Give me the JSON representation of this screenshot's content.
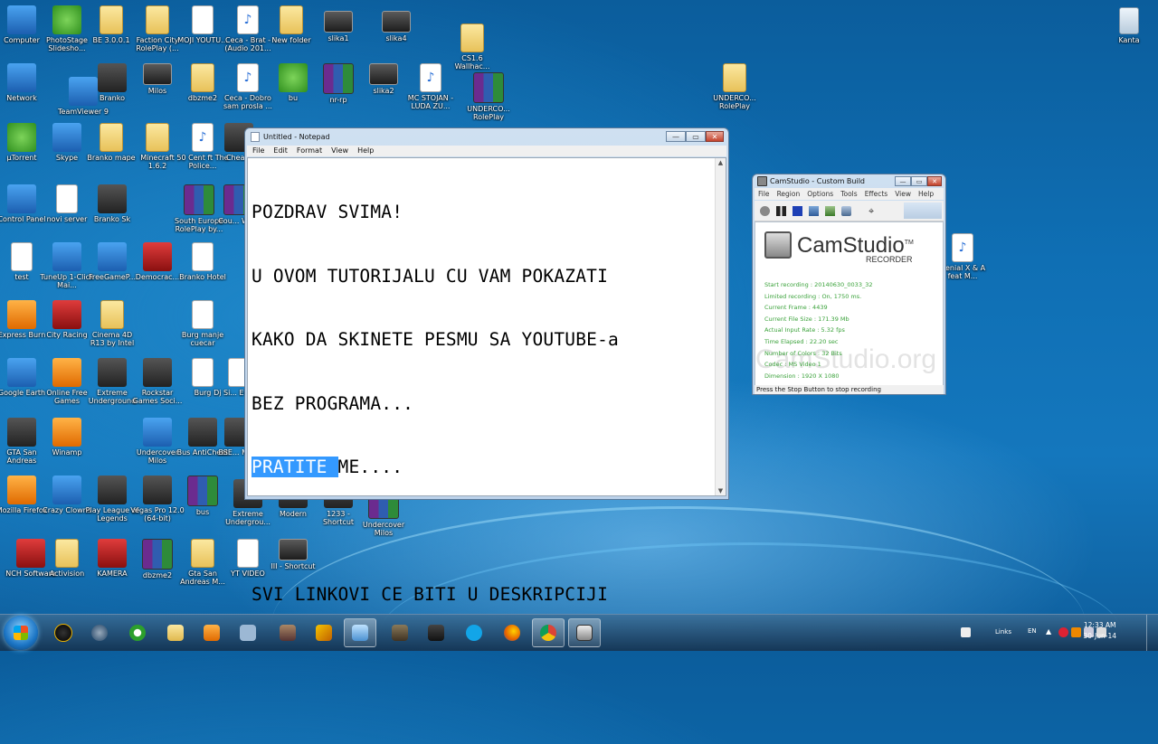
{
  "desktop": {
    "icons": [
      {
        "label": "Computer",
        "glyph": "computer-icon",
        "color": "#5aa0e0"
      },
      {
        "label": "PhotoStage Slidesho...",
        "glyph": "photostage-icon",
        "color": "#2e8b3a"
      },
      {
        "label": "BE 3.0.0.1",
        "glyph": "folder-icon"
      },
      {
        "label": "Faction City RolePlay (...",
        "glyph": "folder-icon"
      },
      {
        "label": "MOJI YOUTU...",
        "glyph": "document-icon"
      },
      {
        "label": "Ceca - Brat - (Audio 201...",
        "glyph": "mp3-icon"
      },
      {
        "label": "New folder",
        "glyph": "folder-icon"
      },
      {
        "label": "slika1",
        "glyph": "image-icon"
      },
      {
        "label": "slika4",
        "glyph": "image-icon"
      },
      {
        "label": "CS1.6 Wallhac...",
        "glyph": "folder-icon"
      },
      {
        "label": "Kanta",
        "glyph": "recycle-bin-icon"
      },
      {
        "label": "Network",
        "glyph": "network-icon"
      },
      {
        "label": "TeamViewer 9",
        "glyph": "teamviewer-icon"
      },
      {
        "label": "Branko",
        "glyph": "app-icon"
      },
      {
        "label": "Milos",
        "glyph": "image-icon"
      },
      {
        "label": "dbzme2",
        "glyph": "folder-icon"
      },
      {
        "label": "Ceca - Dobro sam prosla ...",
        "glyph": "mp3-icon"
      },
      {
        "label": "bu",
        "glyph": "chrome-icon"
      },
      {
        "label": "nr-rp",
        "glyph": "winrar-icon"
      },
      {
        "label": "slika2",
        "glyph": "image-icon"
      },
      {
        "label": "MC STOJAN - LUDA ZU...",
        "glyph": "mp3-icon"
      },
      {
        "label": "UNDERCO... RolePlay",
        "glyph": "winrar-icon"
      },
      {
        "label": "UNDERCO... RolePlay",
        "glyph": "folder-icon"
      },
      {
        "label": "µTorrent",
        "glyph": "utorrent-icon"
      },
      {
        "label": "Skype",
        "glyph": "skype-icon"
      },
      {
        "label": "Branko mape",
        "glyph": "folder-icon"
      },
      {
        "label": "Minecraft 1.6.2",
        "glyph": "folder-icon"
      },
      {
        "label": "50 Cent ft The Police...",
        "glyph": "mp3-icon"
      },
      {
        "label": "Chea...",
        "glyph": "app-icon"
      },
      {
        "label": "Control Panel",
        "glyph": "control-panel-icon"
      },
      {
        "label": "novi server",
        "glyph": "document-icon"
      },
      {
        "label": "Branko Sk",
        "glyph": "app-icon"
      },
      {
        "label": "South Europe RolePlay by...",
        "glyph": "winrar-icon"
      },
      {
        "label": "Cou... Wo...",
        "glyph": "winrar-icon"
      },
      {
        "label": "test",
        "glyph": "document-icon"
      },
      {
        "label": "TuneUp 1-Click Mai...",
        "glyph": "tuneup-icon"
      },
      {
        "label": "FreeGameP...",
        "glyph": "freegame-icon"
      },
      {
        "label": "Democrac...",
        "glyph": "democracy-icon"
      },
      {
        "label": "Branko Hotel",
        "glyph": "document-icon"
      },
      {
        "label": "Express Burn",
        "glyph": "express-burn-icon"
      },
      {
        "label": "City Racing",
        "glyph": "city-racing-icon"
      },
      {
        "label": "Cinema 4D R13 by Intel",
        "glyph": "folder-icon"
      },
      {
        "label": "Burg manje cuecar",
        "glyph": "document-icon"
      },
      {
        "label": "Google Earth",
        "glyph": "google-earth-icon"
      },
      {
        "label": "Online Free Games",
        "glyph": "online-games-icon"
      },
      {
        "label": "Extreme Underground",
        "glyph": "car-icon"
      },
      {
        "label": "Rockstar Games Soci...",
        "glyph": "rockstar-icon"
      },
      {
        "label": "Burg",
        "glyph": "document-icon"
      },
      {
        "label": "Dj Si... Evan...",
        "glyph": "document-icon"
      },
      {
        "label": "GTA San Andreas",
        "glyph": "gta-icon"
      },
      {
        "label": "Winamp",
        "glyph": "winamp-icon"
      },
      {
        "label": "Undercover Milos",
        "glyph": "power-icon"
      },
      {
        "label": "Bus AntiCheat",
        "glyph": "bus-icon"
      },
      {
        "label": "BSE... Ma...",
        "glyph": "app-icon"
      },
      {
        "label": "Mozilla Firefox",
        "glyph": "firefox-icon"
      },
      {
        "label": "Crazy Clowns",
        "glyph": "joystick-icon"
      },
      {
        "label": "Play League of Legends",
        "glyph": "lol-icon"
      },
      {
        "label": "Vegas Pro 12.0 (64-bit)",
        "glyph": "vegas-icon"
      },
      {
        "label": "bus",
        "glyph": "winrar-icon"
      },
      {
        "label": "Extreme Undergrou...",
        "glyph": "car-icon"
      },
      {
        "label": "Modern",
        "glyph": "app-icon"
      },
      {
        "label": "1233 - Shortcut",
        "glyph": "app-icon"
      },
      {
        "label": "Undercover Milos",
        "glyph": "winrar-icon"
      },
      {
        "label": "NCH Software",
        "glyph": "nch-icon"
      },
      {
        "label": "Activision",
        "glyph": "folder-icon"
      },
      {
        "label": "KAMERA",
        "glyph": "kamera-icon"
      },
      {
        "label": "dbzme2",
        "glyph": "winrar-icon"
      },
      {
        "label": "Gta San Andreas M...",
        "glyph": "folder-icon"
      },
      {
        "label": "YT VIDEO",
        "glyph": "document-icon"
      },
      {
        "label": "III - Shortcut",
        "glyph": "image-icon"
      },
      {
        "label": "Denial X & A feat M...",
        "glyph": "mp3-icon"
      }
    ]
  },
  "notepad": {
    "title": "Untitled - Notepad",
    "menus": [
      "File",
      "Edit",
      "Format",
      "View",
      "Help"
    ],
    "lines": [
      "POZDRAV SVIMA!",
      "U OVOM TUTORIJALU CU VAM POKAZATI",
      "KAKO DA SKINETE PESMU SA YOUTUBE-a",
      "BEZ PROGRAMA...",
      "",
      "",
      "SVI LINKOVI CE BITI U DESKRIPCIJI"
    ],
    "selected_text": "PRATITE ",
    "after_selection": "ME....",
    "controls": {
      "minimize": "—",
      "maximize": "▭",
      "close": "✕"
    }
  },
  "camstudio": {
    "title": "CamStudio - Custom Build",
    "menus": [
      "File",
      "Region",
      "Options",
      "Tools",
      "Effects",
      "View",
      "Help"
    ],
    "brand": "CamStudio",
    "tm": "TM",
    "subbrand": "RECORDER",
    "watermark": "CamStudio.org",
    "stats": [
      "Start recording : 20140630_0033_32",
      "Limited recording : On, 1750 ms.",
      "Current Frame : 4439",
      "Current File Size : 171.39 Mb",
      "Actual Input Rate : 5.32 fps",
      "Time Elapsed : 22.20 sec",
      "Number of Colors : 32 Bits",
      "Codec : MS Video 1",
      "Dimension : 1920 X 1080"
    ],
    "status": "Press the Stop Button to stop recording"
  },
  "taskbar": {
    "links_label": "Links",
    "language": "EN",
    "time": "12:33 AM",
    "date": "30-Jun-14"
  }
}
